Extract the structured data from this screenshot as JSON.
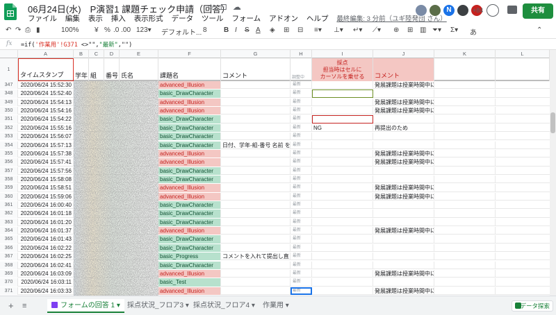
{
  "title": {
    "text": "06月24日(水)　P演習1 課題チェック申請（回答）"
  },
  "menu": [
    "ファイル",
    "編集",
    "表示",
    "挿入",
    "表示形式",
    "データ",
    "ツール",
    "フォーム",
    "アドオン",
    "ヘルプ"
  ],
  "last_edit": "最終編集: 3 分前（ユギ陸発団 さん）",
  "more_users": "+84",
  "share_label": "共有",
  "toolbar": {
    "zoom": "100%",
    "currency": "¥",
    "percent": "%",
    "decimals": ".0 .00",
    "number_format": "123▾",
    "font": "デフォルト...",
    "font_size": "8",
    "bold": "B",
    "italic": "I",
    "strike": "S",
    "text_color": "A",
    "more": "あ"
  },
  "formula": {
    "prefix": "=if(",
    "ref": "'作業用'!G371",
    "mid": " <>\"\",",
    "str": "\"最新\"",
    "suffix": ",\"\")"
  },
  "columns": [
    "A",
    "B",
    "C",
    "D",
    "E",
    "F",
    "G",
    "H",
    "I",
    "J",
    "K",
    "L"
  ],
  "headers": {
    "timestamp": "タイムスタンプ",
    "year": "学年",
    "class": "組",
    "number": "番号",
    "name": "氏名",
    "task": "課題名",
    "comment": "コメント",
    "h": "調整中",
    "score_title": "採点",
    "score_note1": "担当時はセルに",
    "score_note2": "カーソルを乗せる",
    "comment2": "コメント"
  },
  "rows": [
    {
      "n": "347",
      "ts": "2020/06/24 15:52:30",
      "task": "advanced_Illusion",
      "type": "pink",
      "cmt": "",
      "sc": "",
      "cj": "発展課題は授業時間中にフィードバックしません"
    },
    {
      "n": "348",
      "ts": "2020/06/24 15:52:40",
      "task": "basic_DrawCharacter",
      "type": "green",
      "cmt": "",
      "sc": "",
      "cj": ""
    },
    {
      "n": "349",
      "ts": "2020/06/24 15:54:13",
      "task": "advanced_Illusion",
      "type": "pink",
      "cmt": "",
      "sc": "",
      "cj": "発展課題は授業時間中にフィードバックしません"
    },
    {
      "n": "350",
      "ts": "2020/06/24 15:54:16",
      "task": "advanced_Illusion",
      "type": "pink",
      "cmt": "",
      "sc": "",
      "cj": "発展課題は授業時間中にフィードバックしません"
    },
    {
      "n": "351",
      "ts": "2020/06/24 15:54:22",
      "task": "basic_DrawCharacter",
      "type": "green",
      "cmt": "",
      "sc": "",
      "cj": ""
    },
    {
      "n": "352",
      "ts": "2020/06/24 15:55:16",
      "task": "basic_DrawCharacter",
      "type": "green",
      "cmt": "",
      "sc": "NG",
      "cj": "再提出のため"
    },
    {
      "n": "353",
      "ts": "2020/06/24 15:56:07",
      "task": "basic_DrawCharacter",
      "type": "green",
      "cmt": "",
      "sc": "",
      "cj": ""
    },
    {
      "n": "354",
      "ts": "2020/06/24 15:57:13",
      "task": "basic_DrawCharacter",
      "type": "green",
      "cmt": "日付、学年-組-番号 名前 を記",
      "sc": "",
      "cj": ""
    },
    {
      "n": "355",
      "ts": "2020/06/24 15:57:38",
      "task": "advanced_Illusion",
      "type": "pink",
      "cmt": "",
      "sc": "",
      "cj": "発展課題は授業時間中にフィードバックしません"
    },
    {
      "n": "356",
      "ts": "2020/06/24 15:57:41",
      "task": "advanced_Illusion",
      "type": "pink",
      "cmt": "",
      "sc": "",
      "cj": "発展課題は授業時間中にフィードバックしません"
    },
    {
      "n": "357",
      "ts": "2020/06/24 15:57:56",
      "task": "basic_DrawCharacter",
      "type": "green",
      "cmt": "",
      "sc": "",
      "cj": ""
    },
    {
      "n": "358",
      "ts": "2020/06/24 15:58:08",
      "task": "basic_DrawCharacter",
      "type": "green",
      "cmt": "",
      "sc": "",
      "cj": ""
    },
    {
      "n": "359",
      "ts": "2020/06/24 15:58:51",
      "task": "advanced_Illusion",
      "type": "pink",
      "cmt": "",
      "sc": "",
      "cj": "発展課題は授業時間中にフィードバックしません"
    },
    {
      "n": "360",
      "ts": "2020/06/24 15:59:06",
      "task": "advanced_Illusion",
      "type": "pink",
      "cmt": "",
      "sc": "",
      "cj": "発展課題は授業時間中にフィードバックしません"
    },
    {
      "n": "361",
      "ts": "2020/06/24 16:00:40",
      "task": "basic_DrawCharacter",
      "type": "green",
      "cmt": "",
      "sc": "",
      "cj": ""
    },
    {
      "n": "362",
      "ts": "2020/06/24 16:01:18",
      "task": "basic_DrawCharacter",
      "type": "green",
      "cmt": "",
      "sc": "",
      "cj": ""
    },
    {
      "n": "363",
      "ts": "2020/06/24 16:01:20",
      "task": "basic_DrawCharacter",
      "type": "green",
      "cmt": "",
      "sc": "",
      "cj": ""
    },
    {
      "n": "364",
      "ts": "2020/06/24 16:01:37",
      "task": "advanced_Illusion",
      "type": "pink",
      "cmt": "",
      "sc": "",
      "cj": "発展課題は授業時間中にフィードバックしません"
    },
    {
      "n": "365",
      "ts": "2020/06/24 16:01:43",
      "task": "basic_DrawCharacter",
      "type": "green",
      "cmt": "",
      "sc": "",
      "cj": ""
    },
    {
      "n": "366",
      "ts": "2020/06/24 16:02:22",
      "task": "basic_DrawCharacter",
      "type": "green",
      "cmt": "",
      "sc": "",
      "cj": ""
    },
    {
      "n": "367",
      "ts": "2020/06/24 16:02:25",
      "task": "basic_Progress",
      "type": "green",
      "cmt": "コメントを入れて提出し直し",
      "sc": "",
      "cj": ""
    },
    {
      "n": "368",
      "ts": "2020/06/24 16:02:41",
      "task": "basic_DrawCharacter",
      "type": "green",
      "cmt": "",
      "sc": "",
      "cj": ""
    },
    {
      "n": "369",
      "ts": "2020/06/24 16:03:09",
      "task": "advanced_Illusion",
      "type": "pink",
      "cmt": "",
      "sc": "",
      "cj": "発展課題は授業時間中にフィードバックしません"
    },
    {
      "n": "370",
      "ts": "2020/06/24 16:03:11",
      "task": "basic_Test",
      "type": "green",
      "cmt": "",
      "sc": "",
      "cj": ""
    },
    {
      "n": "371",
      "ts": "2020/06/24 16:03:33",
      "task": "advanced_Illusion",
      "type": "pink",
      "cmt": "",
      "sc": "",
      "cj": "発展課題は授業時間中にフィードバックしません"
    }
  ],
  "h_cell_text": "最新",
  "tabs": [
    {
      "label": "フォームの回答 1 ▾",
      "active": true
    },
    {
      "label": "採点状況_フロア3 ▾",
      "active": false
    },
    {
      "label": "採点状況_フロア4 ▾",
      "active": false
    },
    {
      "label": "作業用 ▾",
      "active": false
    }
  ],
  "explore_label": "データ探索",
  "colors": {
    "accent": "#188038",
    "pink": "#f4c7c3",
    "green": "#b7e1cd",
    "selected_border": "#1a73e8"
  }
}
